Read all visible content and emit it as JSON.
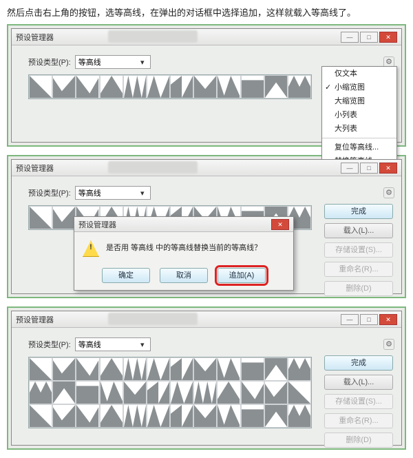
{
  "caption": "然后点击右上角的按钮，选等高线，在弹出的对话框中选择追加，这样就载入等高线了。",
  "window": {
    "title": "预设管理器",
    "min": "—",
    "max": "□",
    "close": "✕",
    "typeLabel": "预设类型(P):",
    "typeValue": "等高线",
    "gear": "⚙"
  },
  "menu": {
    "items": [
      {
        "label": "仅文本",
        "chk": false
      },
      {
        "label": "小缩览图",
        "chk": true
      },
      {
        "label": "大缩览图",
        "chk": false
      },
      {
        "label": "小列表",
        "chk": false
      },
      {
        "label": "大列表",
        "chk": false
      }
    ],
    "items2": [
      {
        "label": "复位等高线..."
      },
      {
        "label": "替换等高线..."
      }
    ],
    "selected": "等高线"
  },
  "side": {
    "done": "完成",
    "load": "载入(L)...",
    "save": "存储设置(S)...",
    "rename": "重命名(R)...",
    "delete": "删除(D)"
  },
  "dialog": {
    "title": "预设管理器",
    "msg": "是否用 等高线 中的等高线替换当前的等高线？",
    "ok": "确定",
    "cancel": "取消",
    "append": "追加(A)"
  },
  "shapes": [
    "0,100 0,0 100,100",
    "0,100 0,10 40,70 100,0 100,100",
    "0,100 0,0 60,80 100,10 100,100",
    "0,100 0,80 50,0 100,80 100,100",
    "0,100 20,0 40,100 60,0 80,100 100,0 100,100",
    "0,100 30,0 60,100 100,0 100,100",
    "0,100 0,40 50,0 50,100 100,0 100,100",
    "0,100 0,0 50,60 100,0 100,100",
    "0,100 0,0 30,90 60,0 100,90 100,100",
    "0,100 0,20 100,20 100,100",
    "0,100 0,0 100,0 100,100 50,30",
    "0,100 0,50 25,0 50,50 75,0 100,50 100,100"
  ]
}
